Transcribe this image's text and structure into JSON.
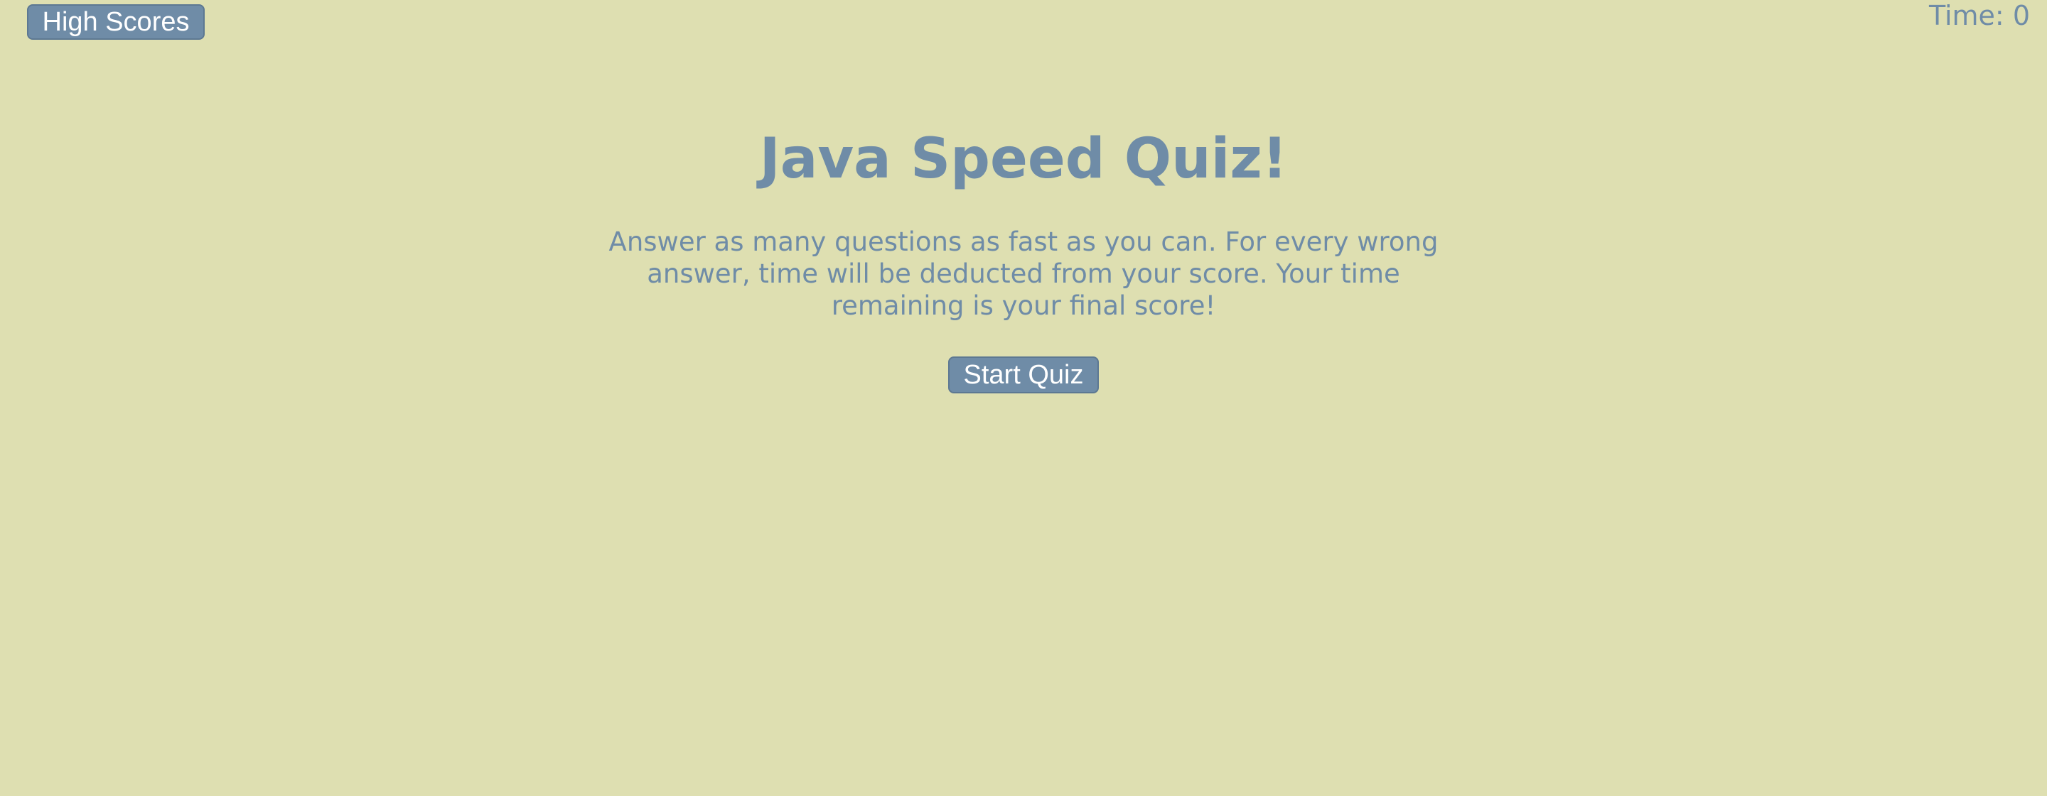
{
  "header": {
    "high_scores_label": "High Scores",
    "timer_text": "Time: 0"
  },
  "intro": {
    "title": "Java Speed Quiz!",
    "instructions": "Answer as many questions as fast as you can. For every wrong answer, time will be deducted from your score. Your time remaining is your final score!",
    "start_label": "Start Quiz"
  },
  "colors": {
    "background": "#dedfb1",
    "accent": "#6f8ca7",
    "button_text": "#ffffff"
  }
}
